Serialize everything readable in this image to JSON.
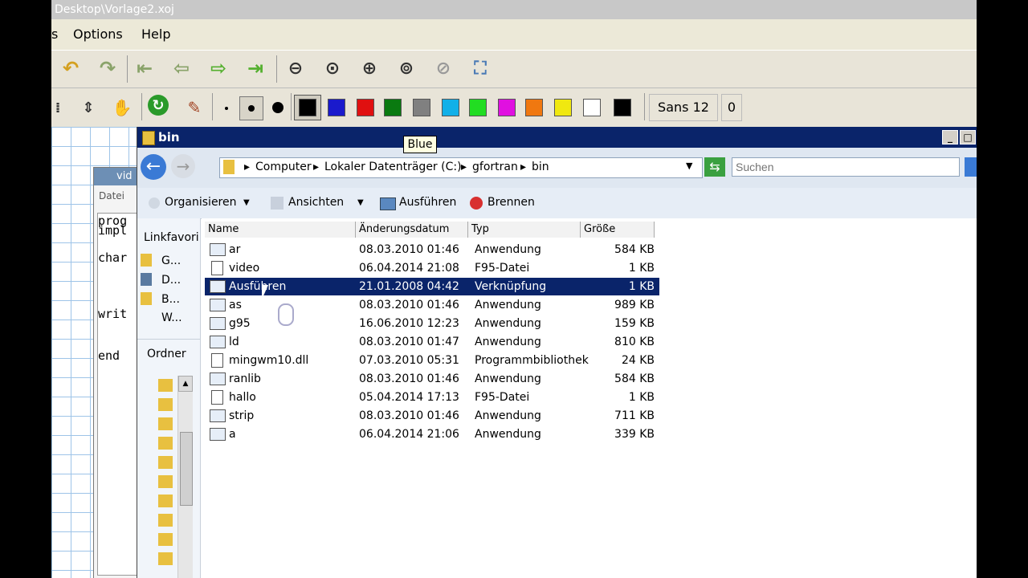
{
  "app": {
    "title": "Desktop\\Vorlage2.xoj",
    "menu": [
      "s",
      "Options",
      "Help"
    ],
    "font_label": "Sans 12",
    "font_value": "0",
    "colors": [
      {
        "name": "black",
        "hex": "#000000"
      },
      {
        "name": "blue",
        "hex": "#1a1acc"
      },
      {
        "name": "red",
        "hex": "#e01010"
      },
      {
        "name": "green",
        "hex": "#0a7a10"
      },
      {
        "name": "gray",
        "hex": "#808080"
      },
      {
        "name": "light-blue",
        "hex": "#12b0e8"
      },
      {
        "name": "light-green",
        "hex": "#22dd22"
      },
      {
        "name": "magenta",
        "hex": "#e010e0"
      },
      {
        "name": "orange",
        "hex": "#f07810"
      },
      {
        "name": "yellow",
        "hex": "#f0e810"
      },
      {
        "name": "white",
        "hex": "#ffffff"
      },
      {
        "name": "black2",
        "hex": "#000000"
      }
    ],
    "tooltip": "Blue"
  },
  "editor": {
    "title": "vid",
    "menu": "Datei",
    "code_lines": [
      "prog",
      "impl",
      "",
      "char",
      "",
      "",
      "writ",
      "",
      "end"
    ]
  },
  "explorer": {
    "title": "bin",
    "breadcrumb": [
      "Computer",
      "Lokaler Datenträger (C:)",
      "gfortran",
      "bin"
    ],
    "search_placeholder": "Suchen",
    "commands": [
      "Organisieren",
      "Ansichten",
      "Ausführen",
      "Brennen"
    ],
    "nav": {
      "favorites_label": "Linkfavori",
      "favorites": [
        "G...",
        "D...",
        "B...",
        "W..."
      ],
      "folders_label": "Ordner"
    },
    "columns": [
      "Name",
      "Änderungsdatum",
      "Typ",
      "Größe"
    ],
    "files": [
      {
        "name": "ar",
        "date": "08.03.2010 01:46",
        "type": "Anwendung",
        "size": "584 KB",
        "icon": "app"
      },
      {
        "name": "video",
        "date": "06.04.2014 21:08",
        "type": "F95-Datei",
        "size": "1 KB",
        "icon": "doc"
      },
      {
        "name": "Ausführen",
        "date": "21.01.2008 04:42",
        "type": "Verknüpfung",
        "size": "1 KB",
        "icon": "shortcut",
        "selected": true
      },
      {
        "name": "as",
        "date": "08.03.2010 01:46",
        "type": "Anwendung",
        "size": "989 KB",
        "icon": "app"
      },
      {
        "name": "g95",
        "date": "16.06.2010 12:23",
        "type": "Anwendung",
        "size": "159 KB",
        "icon": "app"
      },
      {
        "name": "ld",
        "date": "08.03.2010 01:47",
        "type": "Anwendung",
        "size": "810 KB",
        "icon": "app"
      },
      {
        "name": "mingwm10.dll",
        "date": "07.03.2010 05:31",
        "type": "Programmbibliothek",
        "size": "24 KB",
        "icon": "doc"
      },
      {
        "name": "ranlib",
        "date": "08.03.2010 01:46",
        "type": "Anwendung",
        "size": "584 KB",
        "icon": "app"
      },
      {
        "name": "hallo",
        "date": "05.04.2014 17:13",
        "type": "F95-Datei",
        "size": "1 KB",
        "icon": "doc"
      },
      {
        "name": "strip",
        "date": "08.03.2010 01:46",
        "type": "Anwendung",
        "size": "711 KB",
        "icon": "app"
      },
      {
        "name": "a",
        "date": "06.04.2014 21:06",
        "type": "Anwendung",
        "size": "339 KB",
        "icon": "app"
      }
    ]
  }
}
